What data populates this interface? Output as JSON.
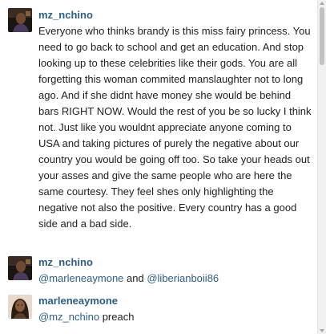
{
  "colors": {
    "username": "#2e5e86",
    "mention": "#2e5e86",
    "text": "#222222",
    "background": "#ffffff"
  },
  "comments": [
    {
      "avatar_icon": "avatar-dark-portrait",
      "username": "mz_nchino",
      "text": "Everyone who thinks brandy is this miss fairy princess. You need to go back to school and get an education. And stop looking up to these celebrities like their gods. You are all forgetting this woman commited manslaughter not to long ago. And if she didnt have money she would be behind bars RIGHT NOW. Would the rest of you be so lucky I think not. Just like you wouldnt appreciate anyone coming to USA and taking pictures of purely the negative about our country you would be going off too. So take your heads out your asses and give the same people who are here the same courtesy. They feel shes only highlighting the negative not also the positive. Every country has a good side and a bad side."
    },
    {
      "avatar_icon": "avatar-dark-portrait",
      "username": "mz_nchino",
      "mention_1": "@marleneaymone",
      "joiner": " and ",
      "mention_2": "@liberianboii86"
    },
    {
      "avatar_icon": "avatar-woman-portrait",
      "username": "marleneaymone",
      "mention_1": "@mz_nchino",
      "text": " preach"
    }
  ]
}
